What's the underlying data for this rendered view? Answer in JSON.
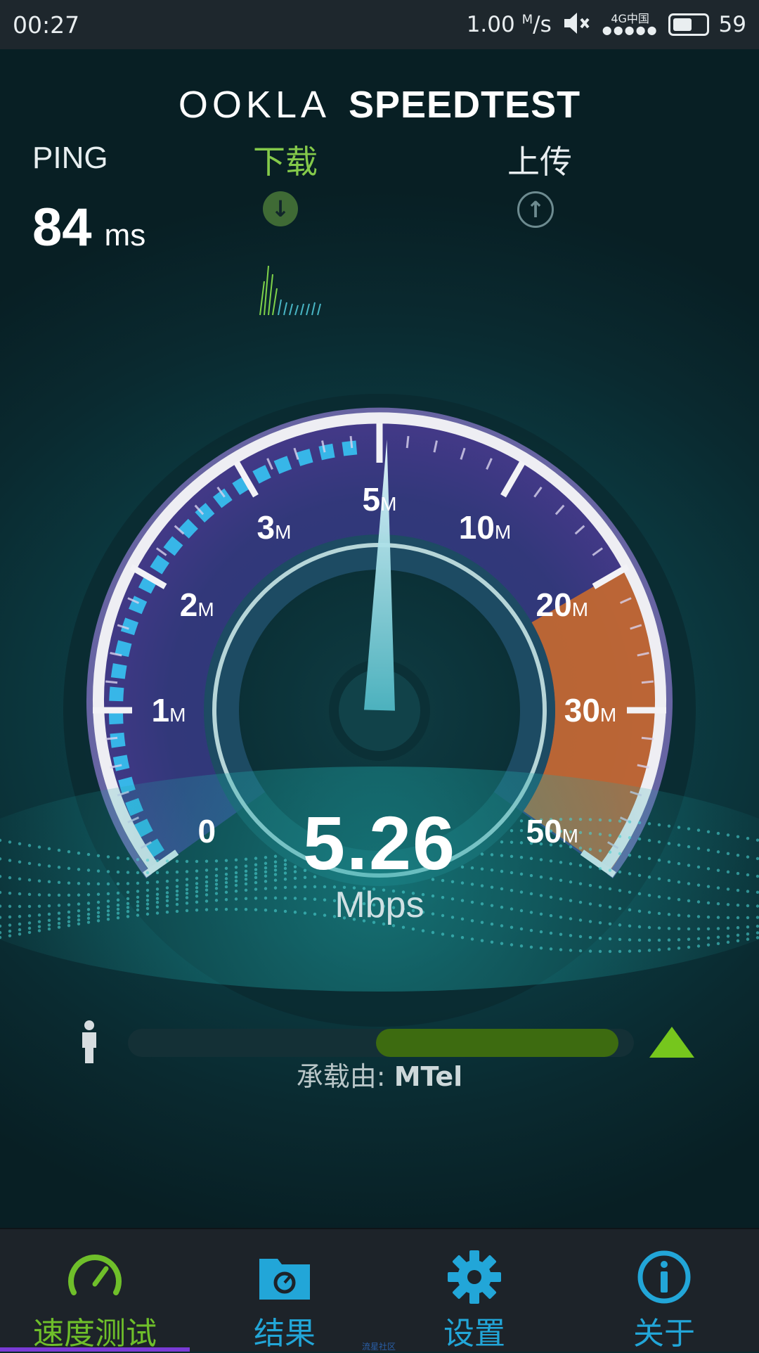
{
  "status_bar": {
    "time": "00:27",
    "net_speed": "1.00",
    "net_speed_unit_top": "M",
    "net_speed_unit_bottom": "/s",
    "signal_label": "4G",
    "signal_extra": "中国",
    "battery_level": "59",
    "mute_icon": "mute-icon"
  },
  "header": {
    "brand_left": "OOKLA",
    "brand_right": "SPEEDTEST"
  },
  "ping": {
    "label": "PING",
    "value": "84",
    "unit": "ms"
  },
  "download": {
    "label": "下载",
    "icon": "arrow-down-icon",
    "color": "#84c94a"
  },
  "upload": {
    "label": "上传",
    "icon": "arrow-up-icon"
  },
  "gauge": {
    "ticks": [
      {
        "num": "0",
        "unit": ""
      },
      {
        "num": "1",
        "unit": "M"
      },
      {
        "num": "2",
        "unit": "M"
      },
      {
        "num": "3",
        "unit": "M"
      },
      {
        "num": "5",
        "unit": "M"
      },
      {
        "num": "10",
        "unit": "M"
      },
      {
        "num": "20",
        "unit": "M"
      },
      {
        "num": "30",
        "unit": "M"
      },
      {
        "num": "50",
        "unit": "M"
      }
    ],
    "needle_value": 5.26
  },
  "reading": {
    "value": "5.26",
    "unit": "Mbps"
  },
  "progress": {
    "fill_start": 0.49,
    "fill_end": 0.97,
    "host_prefix": "承载由:",
    "host_name": "MTel"
  },
  "nav": {
    "items": [
      {
        "label": "速度测试",
        "icon": "speedometer-icon",
        "color": "#6fbf2a"
      },
      {
        "label": "结果",
        "icon": "results-folder-icon",
        "color": "#22a6d8"
      },
      {
        "label": "设置",
        "icon": "gear-icon",
        "color": "#22a6d8"
      },
      {
        "label": "关于",
        "icon": "info-icon",
        "color": "#22a6d8"
      }
    ]
  },
  "watermark": "流星社区"
}
